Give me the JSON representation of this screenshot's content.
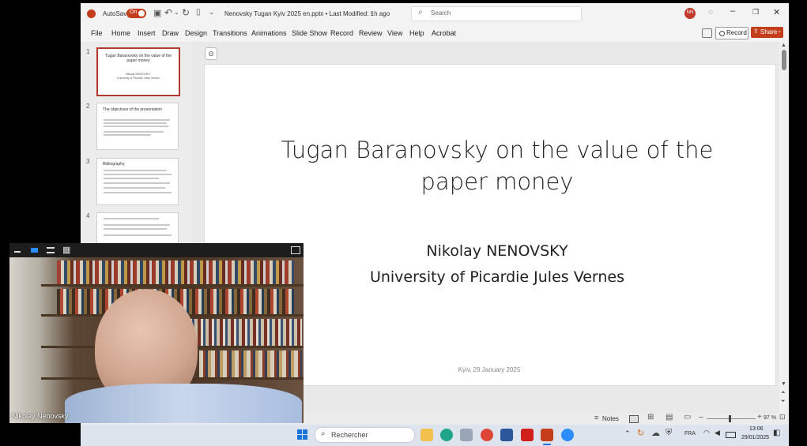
{
  "app": {
    "autosave_label": "AutoSave",
    "autosave_state": "On",
    "doc_title": "Nenovsky Tugan Kyiv 2025 en.pptx • Last Modified: 1h ago",
    "search_placeholder": "Search",
    "user_initials": "NN"
  },
  "ribbon": {
    "tabs": [
      "File",
      "Home",
      "Insert",
      "Draw",
      "Design",
      "Transitions",
      "Animations",
      "Slide Show",
      "Record",
      "Review",
      "View",
      "Help",
      "Acrobat"
    ],
    "record_label": "Record",
    "share_label": "Share"
  },
  "thumbnails": [
    {
      "num": "1",
      "title": "Tugan Baranovsky on the value of the paper money",
      "sub": "Nikolay NENOVSKY\nUniversity of Picardie Jules Vernes"
    },
    {
      "num": "2",
      "title": "The objectives of the presentation"
    },
    {
      "num": "3",
      "title": "Bibliography"
    },
    {
      "num": "4",
      "title": ""
    }
  ],
  "slide": {
    "title": "Tugan Baranovsky on the value of the paper money",
    "author": "Nikolay NENOVSKY",
    "affiliation": "University of Picardie Jules Vernes",
    "footer": "Kyiv, 29 January 2025"
  },
  "statusbar": {
    "notes_label": "Notes",
    "zoom": "97 %"
  },
  "taskbar": {
    "search_placeholder": "Rechercher",
    "language": "FRA",
    "time": "13:06",
    "date": "29/01/2025"
  },
  "video": {
    "participant_name": "Nikolay Nenovsky"
  },
  "colors": {
    "accent_red": "#c43e1c",
    "autosave_toggle": "#c43e1c",
    "slide_text": "#222222"
  }
}
